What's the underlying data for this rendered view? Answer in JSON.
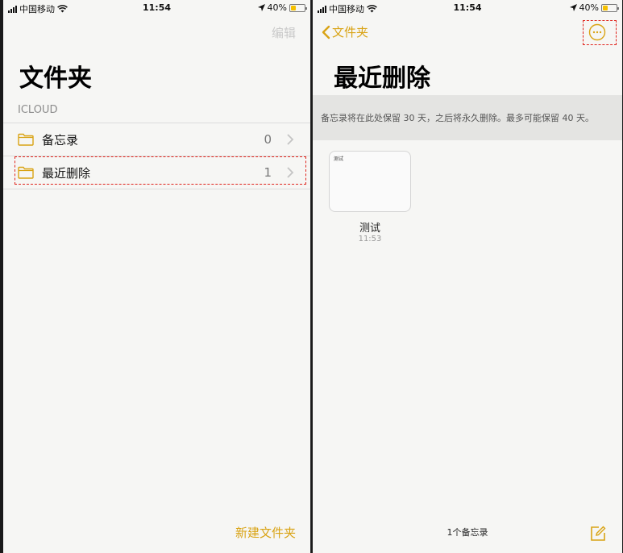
{
  "colors": {
    "accent": "#d9a314",
    "highlight": "#e0241c",
    "background": "#f6f6f4"
  },
  "status_bar": {
    "carrier": "中国移动",
    "time": "11:54",
    "battery": "40%",
    "battery_level": 0.4,
    "icons": [
      "signal-icon",
      "wifi-icon",
      "location-icon",
      "battery-icon"
    ]
  },
  "left": {
    "edit_label": "编辑",
    "title": "文件夹",
    "section": "ICLOUD",
    "folders": [
      {
        "name": "备忘录",
        "count": "0"
      },
      {
        "name": "最近删除",
        "count": "1"
      }
    ],
    "new_folder_label": "新建文件夹"
  },
  "right": {
    "back_label": "文件夹",
    "title": "最近删除",
    "banner": "备忘录将在此处保留 30 天，之后将永久删除。最多可能保留 40 天。",
    "note": {
      "thumb_text": "测试",
      "title": "测试",
      "time": "11:53"
    },
    "note_count": "1个备忘录",
    "icons": [
      "chevron-left-icon",
      "more-icon",
      "compose-icon"
    ]
  }
}
